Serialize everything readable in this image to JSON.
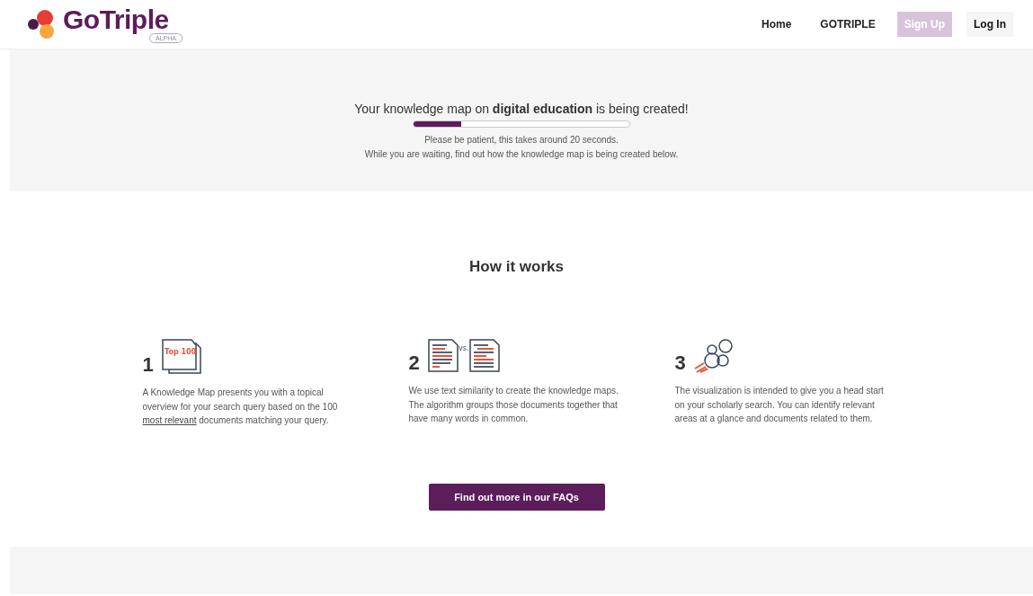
{
  "header": {
    "logo_text": "GoTriple",
    "logo_badge": "ALPHA",
    "nav": [
      {
        "label": "Home",
        "kind": "link"
      },
      {
        "label": "GOTRIPLE",
        "kind": "link"
      },
      {
        "label": "Sign Up",
        "kind": "signup"
      },
      {
        "label": "Log In",
        "kind": "login"
      }
    ]
  },
  "status": {
    "title_before": "Your knowledge map on ",
    "query": "digital education",
    "title_after": " is being created!",
    "level": 0.22,
    "lines": [
      "Please be patient, this takes around 20 seconds.",
      "While you are waiting, find out how the knowledge map is being created below."
    ]
  },
  "how": {
    "heading": "How it works",
    "steps": [
      {
        "number": "1",
        "kind": "top100",
        "icon_text": "Top 100",
        "text_before": "A Knowledge Map presents you with a topical overview for your search query based on the 100 ",
        "link": "most relevant",
        "text_after": " documents matching your query."
      },
      {
        "number": "2",
        "kind": "vs",
        "icon_text": "vs.",
        "text_before": "We use text similarity to create the knowledge maps. The algorithm groups those documents together that have many words in common."
      },
      {
        "number": "3",
        "kind": "bubbles",
        "text_before": "The visualization is intended to give you a head start on your scholarly search. You can identify relevant areas at a glance and documents related to them."
      }
    ],
    "button": "Find out more in our FAQs"
  }
}
